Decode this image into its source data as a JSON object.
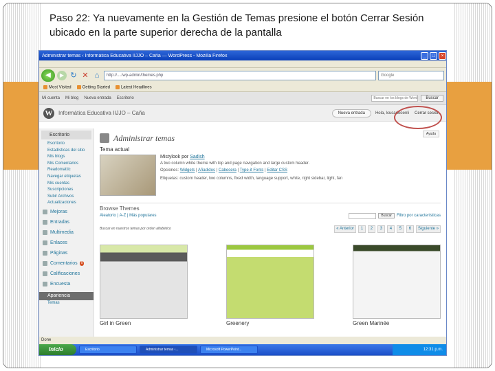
{
  "slide": {
    "title": "Paso 22: Ya nuevamente en la Gestión de Temas presione el botón  Cerrar Sesión ubicado en la parte superior derecha de la pantalla"
  },
  "colors": {
    "accent_orange": "#e8a040",
    "highlight_circle": "#c0504d",
    "wp_link": "#21759b"
  },
  "browser": {
    "title": "Administrar temas ‹ Informática Educativa IIJJO – Caña — WordPress - Mozilla Firefox",
    "url": "http://..../wp-admin/themes.php",
    "search_placeholder": "Google",
    "bookmarks": [
      "Most Visited",
      "Getting Started",
      "Latest Headlines"
    ]
  },
  "admin_bar": {
    "items": [
      "Mi cuenta",
      "Mi blog",
      "Nueva entrada",
      "Escritorio"
    ],
    "search_placeholder": "Buscar en los blogs de WordPress",
    "search_button": "Buscar"
  },
  "wp_header": {
    "site_name": "Informática Educativa IIJJO – Caña",
    "favorite_actions": "Nueva entrada",
    "howdy": "Hola, lcusadeoenli",
    "logout": "Cerrar sesión",
    "help": "Ayuda"
  },
  "sidebar": {
    "head": "Escritorio",
    "subitems": [
      "Escritorio",
      "Estadísticas del sitio",
      "Mis blogs",
      "Mis Comentarios",
      "Readomattic",
      "Navegar etiquetas",
      "Mis cuentas",
      "Suscripciones",
      "Subir Archivos",
      "Actualizaciones"
    ],
    "mejoras": "Mejoras",
    "items": [
      {
        "label": "Entradas",
        "badge": ""
      },
      {
        "label": "Multimedia",
        "badge": ""
      },
      {
        "label": "Enlaces",
        "badge": ""
      },
      {
        "label": "Páginas",
        "badge": ""
      },
      {
        "label": "Comentarios",
        "badge": "0"
      },
      {
        "label": "Calificaciones",
        "badge": ""
      },
      {
        "label": "Encuesta",
        "badge": ""
      }
    ],
    "appearance": "Apariencia",
    "temas": "Temas"
  },
  "main": {
    "title": "Administrar temas",
    "current_label": "Tema actual",
    "current_theme_prefix": "Mistylook por",
    "current_theme_author": "Sadish",
    "current_theme_desc": "A two column white theme with top and page navigation and large custom header.",
    "options_prefix": "Opciones:",
    "options": [
      "Widgets",
      "Añadidos",
      "Cabecera",
      "Type-it Fonts",
      "Editar CSS"
    ],
    "tags": "Etiquetas: custom header, two columns, fixed width, language support, white, right sidebar, light, fan",
    "browse_label": "Browse Themes",
    "browse_links": [
      "Aleatorio",
      "A-Z",
      "Más populares"
    ],
    "search_button": "Buscar",
    "feature_filter": "Filtro por características",
    "pager_info": "Buscar en nuestros temas por orden alfabético",
    "pages": [
      "« Anterior",
      "1",
      "2",
      "3",
      "4",
      "5",
      "6",
      "Siguiente »"
    ],
    "themes": [
      "Girl in Green",
      "Greenery",
      "Green Marinée"
    ]
  },
  "status": {
    "text": "Done"
  },
  "taskbar": {
    "start": "Inicio",
    "tasks": [
      "Escritorio",
      "Administrar temas ‹...",
      "Microsoft PowerPoint..."
    ],
    "clock": "12:31 p.m."
  }
}
